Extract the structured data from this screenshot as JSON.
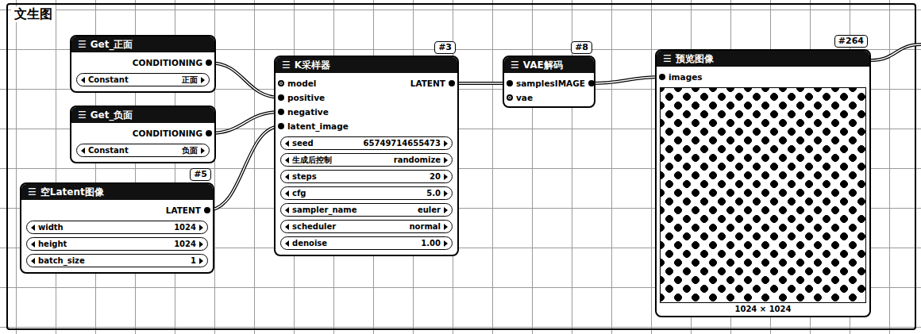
{
  "group": {
    "title": "文生图"
  },
  "nodes": [
    {
      "title": "Get_正面",
      "menu": "☰",
      "badge": null,
      "inputs": [],
      "outputs": [
        {
          "name": "CONDITIONING",
          "linked": true
        }
      ],
      "widgets": [
        {
          "name": "Constant",
          "value": "正面"
        }
      ],
      "caption": null
    },
    {
      "title": "Get_负面",
      "menu": "☰",
      "badge": null,
      "inputs": [],
      "outputs": [
        {
          "name": "CONDITIONING",
          "linked": true
        }
      ],
      "widgets": [
        {
          "name": "Constant",
          "value": "负面"
        }
      ],
      "caption": null
    },
    {
      "title": "空Latent图像",
      "menu": "☰",
      "badge": "#5",
      "inputs": [],
      "outputs": [
        {
          "name": "LATENT",
          "linked": true
        }
      ],
      "widgets": [
        {
          "name": "width",
          "value": "1024"
        },
        {
          "name": "height",
          "value": "1024"
        },
        {
          "name": "batch_size",
          "value": "1"
        }
      ],
      "caption": null
    },
    {
      "title": "K采样器",
      "menu": "☰",
      "badge": "#3",
      "inputs": [
        {
          "name": "model",
          "linked": false
        },
        {
          "name": "positive",
          "linked": true
        },
        {
          "name": "negative",
          "linked": true
        },
        {
          "name": "latent_image",
          "linked": true
        }
      ],
      "outputs": [
        {
          "name": "LATENT",
          "linked": true
        }
      ],
      "widgets": [
        {
          "name": "seed",
          "value": "65749714655473"
        },
        {
          "name": "生成后控制",
          "value": "randomize"
        },
        {
          "name": "steps",
          "value": "20"
        },
        {
          "name": "cfg",
          "value": "5.0"
        },
        {
          "name": "sampler_name",
          "value": "euler"
        },
        {
          "name": "scheduler",
          "value": "normal"
        },
        {
          "name": "denoise",
          "value": "1.00"
        }
      ],
      "caption": null
    },
    {
      "title": "VAE解码",
      "menu": "☰",
      "badge": "#8",
      "inputs": [
        {
          "name": "samples",
          "linked": true
        },
        {
          "name": "vae",
          "linked": false
        }
      ],
      "outputs": [
        {
          "name": "IMAGE",
          "linked": true
        }
      ],
      "widgets": [],
      "caption": null
    },
    {
      "title": "预览图像",
      "menu": "☰",
      "badge": "#264",
      "inputs": [
        {
          "name": "images",
          "linked": true
        }
      ],
      "outputs": [],
      "widgets": [],
      "caption": "1024 × 1024"
    }
  ],
  "links": [
    {
      "from": [
        0,
        0
      ],
      "to": [
        3,
        1
      ]
    },
    {
      "from": [
        1,
        0
      ],
      "to": [
        3,
        2
      ]
    },
    {
      "from": [
        2,
        0
      ],
      "to": [
        3,
        3
      ]
    },
    {
      "from": [
        3,
        0
      ],
      "to": [
        4,
        0
      ]
    },
    {
      "from": [
        4,
        0
      ],
      "to": [
        5,
        0
      ]
    }
  ]
}
